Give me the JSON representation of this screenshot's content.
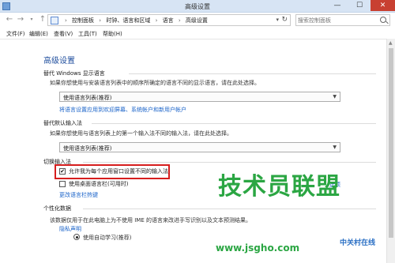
{
  "window": {
    "title": "高级设置",
    "minimize": "—",
    "maximize": "☐",
    "close": "✕"
  },
  "nav": {
    "back": "←",
    "forward": "→",
    "recent": "▾",
    "up": "↑"
  },
  "address": {
    "breadcrumbs": [
      "控制面板",
      "时钟、语言和区域",
      "语言",
      "高级设置"
    ],
    "separator": "›",
    "dropdown": "▾",
    "refresh": "↻"
  },
  "search": {
    "placeholder": "搜索控制面板"
  },
  "menu": [
    "文件(F)",
    "编辑(E)",
    "查看(V)",
    "工具(T)",
    "帮助(H)"
  ],
  "page": {
    "title": "高级设置",
    "display_language": {
      "header": "替代 Windows 显示语言",
      "description": "如果你想使用与安装语言列表中的顺序所确定的语言不同的显示语言，请在此处选择。",
      "selected": "使用语言列表(推荐)",
      "link": "将语言设置应用到欢迎屏幕、系统帐户和新用户帐户"
    },
    "input_method": {
      "header": "替代默认输入法",
      "description": "如果你想使用与语言列表上的第一个输入法不同的输入法，请在此处选择。",
      "selected": "使用语言列表(推荐)"
    },
    "switching": {
      "header": "切换输入法",
      "per_app_label": "允许我为每个应用窗口设置不同的输入法",
      "per_app_checked": "✔",
      "desktop_bar_label": "使用桌面语言栏(可用时)",
      "options_link": "选项",
      "hotkeys_link": "更改语言栏热键"
    },
    "personalization": {
      "header": "个性化数据",
      "description": "该数据仅用于在此电脑上为不使用 IME 的语言来改进手写识别以及文本预测结果。",
      "privacy_link": "隐私声明",
      "auto_learn_label": "使用自动学习(推荐)"
    },
    "scroll_up": "▲"
  },
  "watermark": {
    "big": "技术员联盟",
    "url": "www.jsgho.com",
    "sub": "中关村在线"
  }
}
